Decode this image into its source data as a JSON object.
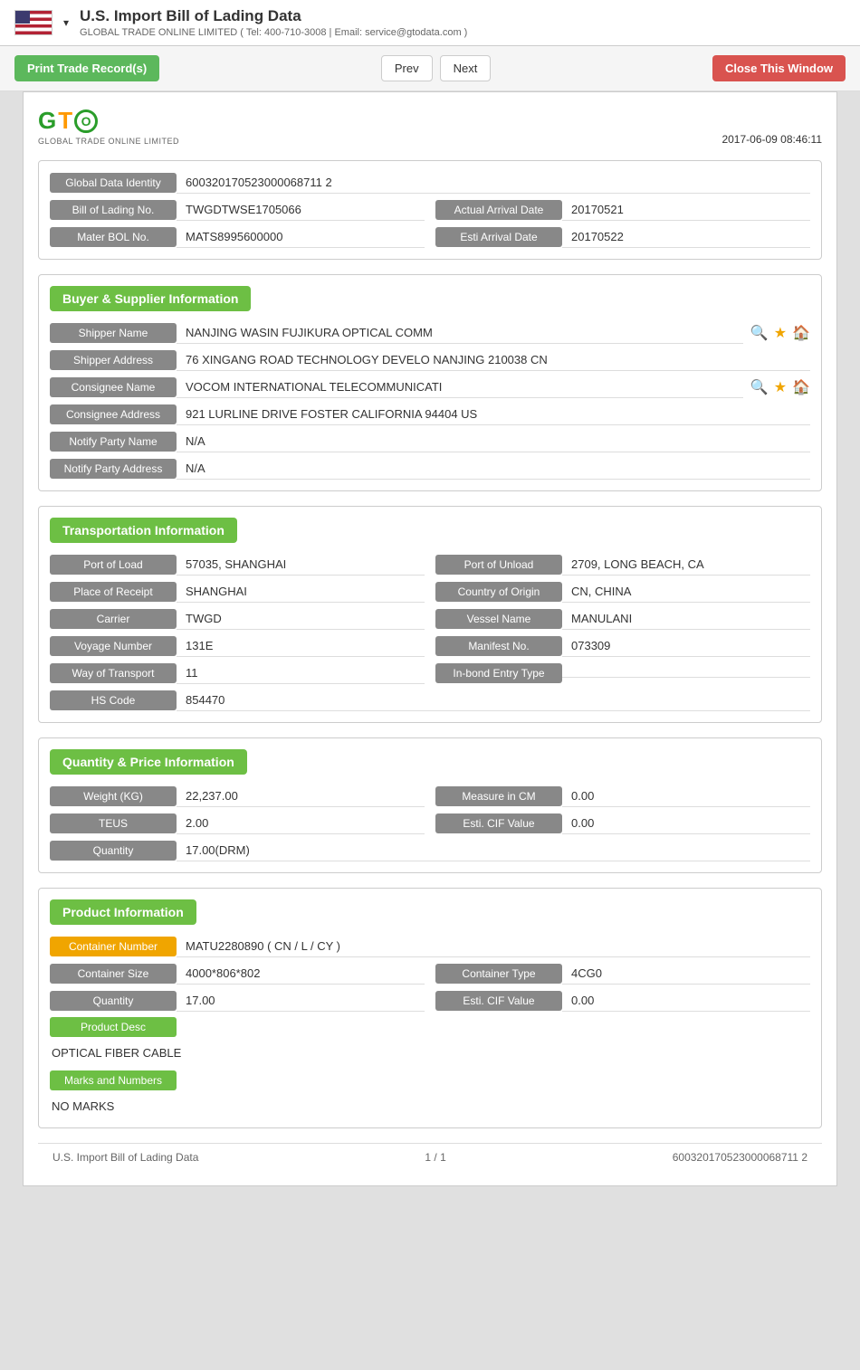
{
  "header": {
    "title": "U.S. Import Bill of Lading Data",
    "subtitle": "GLOBAL TRADE ONLINE LIMITED ( Tel: 400-710-3008 | Email: service@gtodata.com )",
    "timestamp": "2017-06-09 08:46:11"
  },
  "toolbar": {
    "print_label": "Print Trade Record(s)",
    "prev_label": "Prev",
    "next_label": "Next",
    "close_label": "Close This Window"
  },
  "identity": {
    "global_data_identity_label": "Global Data Identity",
    "global_data_identity_value": "600320170523000068711 2",
    "bill_of_lading_label": "Bill of Lading No.",
    "bill_of_lading_value": "TWGDTWSE1705066",
    "actual_arrival_label": "Actual Arrival Date",
    "actual_arrival_value": "20170521",
    "master_bol_label": "Mater BOL No.",
    "master_bol_value": "MATS8995600000",
    "esti_arrival_label": "Esti Arrival Date",
    "esti_arrival_value": "20170522"
  },
  "buyer_supplier": {
    "section_title": "Buyer & Supplier Information",
    "shipper_name_label": "Shipper Name",
    "shipper_name_value": "NANJING WASIN FUJIKURA OPTICAL COMM",
    "shipper_address_label": "Shipper Address",
    "shipper_address_value": "76 XINGANG ROAD TECHNOLOGY DEVELO NANJING 210038 CN",
    "consignee_name_label": "Consignee Name",
    "consignee_name_value": "VOCOM INTERNATIONAL TELECOMMUNICATI",
    "consignee_address_label": "Consignee Address",
    "consignee_address_value": "921 LURLINE DRIVE FOSTER CALIFORNIA 94404 US",
    "notify_party_name_label": "Notify Party Name",
    "notify_party_name_value": "N/A",
    "notify_party_address_label": "Notify Party Address",
    "notify_party_address_value": "N/A"
  },
  "transportation": {
    "section_title": "Transportation Information",
    "port_of_load_label": "Port of Load",
    "port_of_load_value": "57035, SHANGHAI",
    "port_of_unload_label": "Port of Unload",
    "port_of_unload_value": "2709, LONG BEACH, CA",
    "place_of_receipt_label": "Place of Receipt",
    "place_of_receipt_value": "SHANGHAI",
    "country_of_origin_label": "Country of Origin",
    "country_of_origin_value": "CN, CHINA",
    "carrier_label": "Carrier",
    "carrier_value": "TWGD",
    "vessel_name_label": "Vessel Name",
    "vessel_name_value": "MANULANI",
    "voyage_number_label": "Voyage Number",
    "voyage_number_value": "131E",
    "manifest_no_label": "Manifest No.",
    "manifest_no_value": "073309",
    "way_of_transport_label": "Way of Transport",
    "way_of_transport_value": "11",
    "inbond_entry_label": "In-bond Entry Type",
    "inbond_entry_value": "",
    "hs_code_label": "HS Code",
    "hs_code_value": "854470"
  },
  "quantity_price": {
    "section_title": "Quantity & Price Information",
    "weight_label": "Weight (KG)",
    "weight_value": "22,237.00",
    "measure_label": "Measure in CM",
    "measure_value": "0.00",
    "teus_label": "TEUS",
    "teus_value": "2.00",
    "esti_cif_label": "Esti. CIF Value",
    "esti_cif_value": "0.00",
    "quantity_label": "Quantity",
    "quantity_value": "17.00(DRM)"
  },
  "product": {
    "section_title": "Product Information",
    "container_number_label": "Container Number",
    "container_number_value": "MATU2280890 ( CN / L / CY )",
    "container_size_label": "Container Size",
    "container_size_value": "4000*806*802",
    "container_type_label": "Container Type",
    "container_type_value": "4CG0",
    "quantity_label": "Quantity",
    "quantity_value": "17.00",
    "esti_cif_label": "Esti. CIF Value",
    "esti_cif_value": "0.00",
    "product_desc_label": "Product Desc",
    "product_desc_value": "OPTICAL FIBER CABLE",
    "marks_label": "Marks and Numbers",
    "marks_value": "NO MARKS"
  },
  "footer": {
    "left": "U.S. Import Bill of Lading Data",
    "center": "1 / 1",
    "right": "600320170523000068711 2"
  }
}
